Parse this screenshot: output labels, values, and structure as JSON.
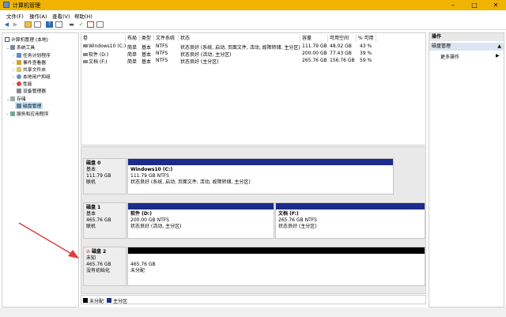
{
  "window": {
    "title": "计算机管理",
    "min": "–",
    "max": "□",
    "close": "✕"
  },
  "menu": [
    "文件(F)",
    "操作(A)",
    "查看(V)",
    "帮助(H)"
  ],
  "toolbar": [
    "back-arrow-icon",
    "forward-arrow-icon",
    "folder-up-icon",
    "grid-icon",
    "help-icon",
    "panel-icon",
    "disk-icon",
    "check-icon",
    "properties-icon",
    "view-icon"
  ],
  "tree": {
    "root": "计算机管理 (本地)",
    "items": [
      {
        "label": "系统工具",
        "level": 1,
        "expanded": true
      },
      {
        "label": "任务计划程序",
        "level": 2
      },
      {
        "label": "事件查看器",
        "level": 2
      },
      {
        "label": "共享文件夹",
        "level": 2
      },
      {
        "label": "本地用户和组",
        "level": 2
      },
      {
        "label": "性能",
        "level": 2
      },
      {
        "label": "设备管理器",
        "level": 2
      },
      {
        "label": "存储",
        "level": 1,
        "expanded": true
      },
      {
        "label": "磁盘管理",
        "level": 2,
        "selected": true
      },
      {
        "label": "服务和应用程序",
        "level": 1
      }
    ]
  },
  "volumes": {
    "headers": [
      "卷",
      "布局",
      "类型",
      "文件系统",
      "状态",
      "容量",
      "可用空间",
      "% 可用"
    ],
    "rows": [
      [
        "Windows10 (C:)",
        "简单",
        "基本",
        "NTFS",
        "状态良好 (系统, 启动, 页面文件, 活动, 故障转储, 主分区)",
        "111.79 GB",
        "48.02 GB",
        "43 %"
      ],
      [
        "软件 (D:)",
        "简单",
        "基本",
        "NTFS",
        "状态良好 (活动, 主分区)",
        "200.00 GB",
        "77.43 GB",
        "39 %"
      ],
      [
        "文档 (F:)",
        "简单",
        "基本",
        "NTFS",
        "状态良好 (主分区)",
        "265.76 GB",
        "156.76 GB",
        "59 %"
      ]
    ]
  },
  "disks": [
    {
      "name": "磁盘 0",
      "type": "基本",
      "size": "111.79 GB",
      "status": "联机",
      "partitions": [
        {
          "title": "Windows10 (C:)",
          "line1": "111.79 GB NTFS",
          "line2": "状态良好 (系统, 启动, 页面文件, 活动, 故障转储, 主分区)",
          "bar_color": "#1c2c8c"
        }
      ]
    },
    {
      "name": "磁盘 1",
      "type": "基本",
      "size": "465.76 GB",
      "status": "联机",
      "partitions": [
        {
          "title": "软件 (D:)",
          "line1": "200.00 GB NTFS",
          "line2": "状态良好 (活动, 主分区)",
          "bar_color": "#1c2c8c"
        },
        {
          "title": "文档 (F:)",
          "line1": "265.76 GB NTFS",
          "line2": "状态良好 (主分区)",
          "bar_color": "#1c2c8c"
        }
      ]
    },
    {
      "name": "磁盘 2",
      "type": "未知",
      "size": "465.76 GB",
      "status": "没有初始化",
      "partitions": [
        {
          "title": "",
          "line1": "465.76 GB",
          "line2": "未分配",
          "bar_color": "#000000"
        }
      ]
    }
  ],
  "legend": [
    {
      "label": "未分配",
      "color": "#000000"
    },
    {
      "label": "主分区",
      "color": "#1c2c8c"
    }
  ],
  "actions": {
    "header": "操作",
    "section": "磁盘管理",
    "more": "更多操作"
  },
  "colors": {
    "titlebar": "#f0b400",
    "primary_partition": "#1c2c8c",
    "unallocated": "#000000",
    "arrow": "#e23b3b"
  }
}
